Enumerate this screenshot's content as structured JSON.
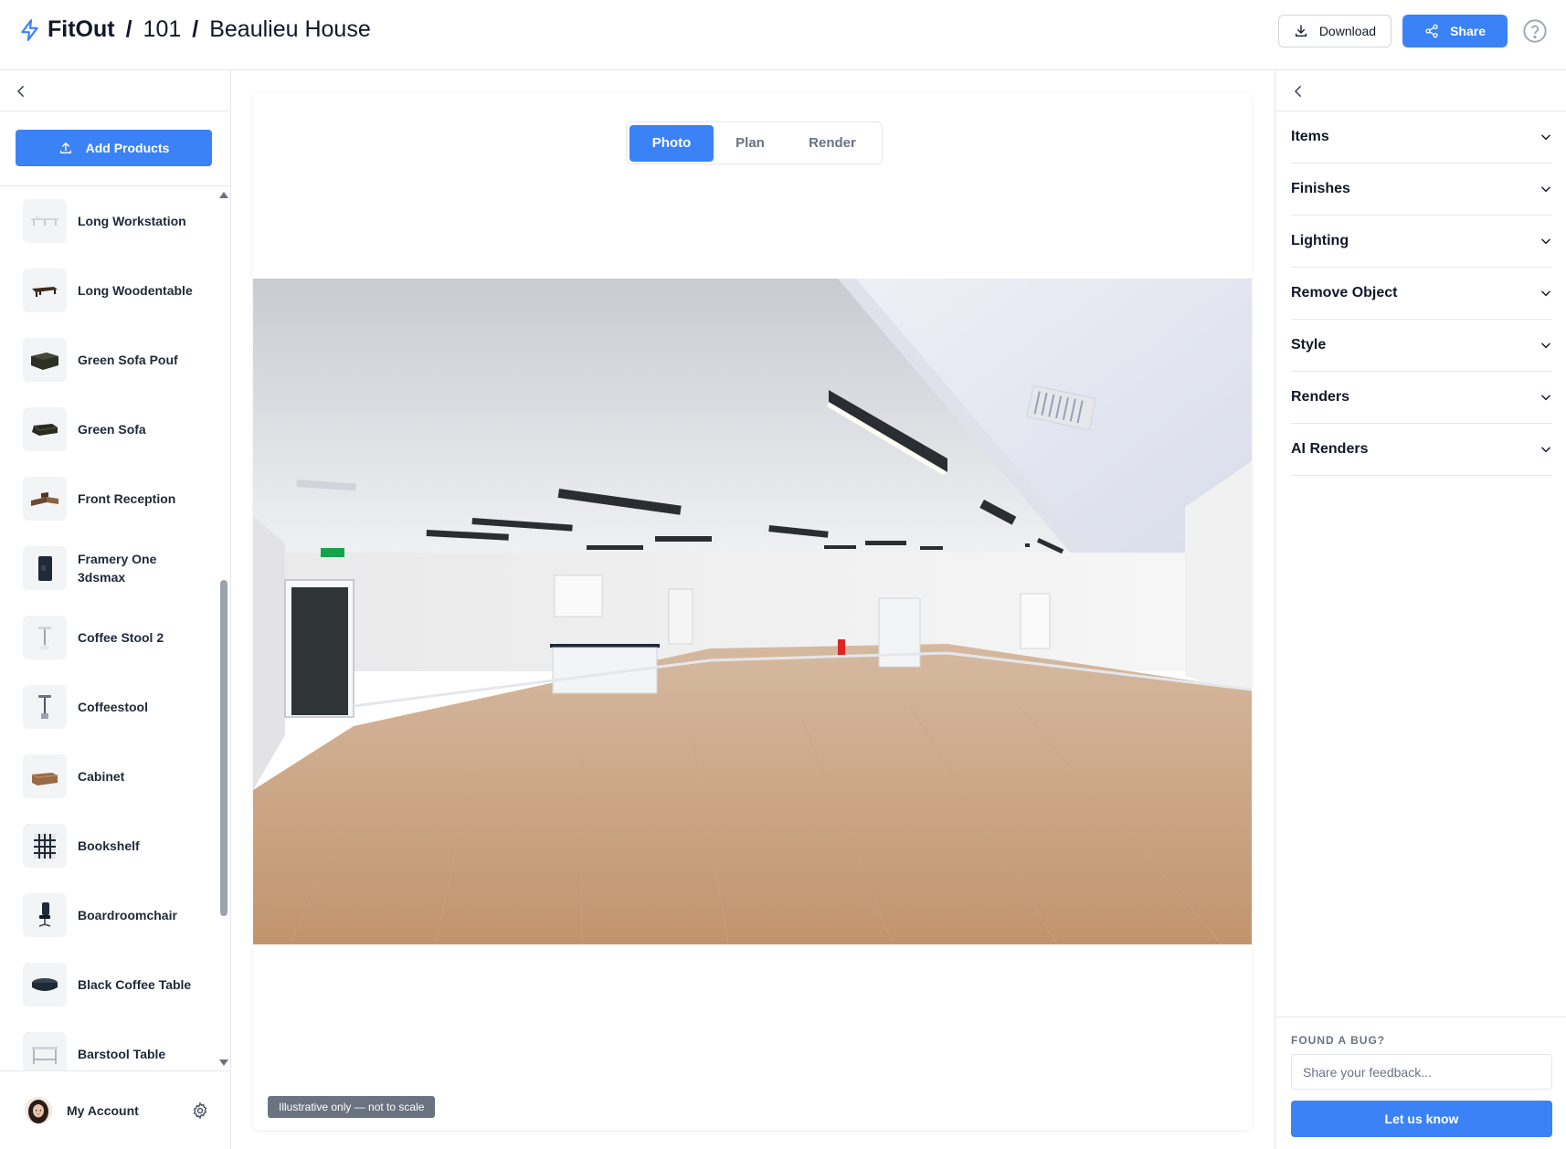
{
  "header": {
    "app_name": "FitOut",
    "separator": "/",
    "project_number": "101",
    "project_name": "Beaulieu House",
    "download_label": "Download",
    "share_label": "Share"
  },
  "left_sidebar": {
    "add_products_label": "Add Products",
    "products": [
      {
        "name": "Long Workstation"
      },
      {
        "name": "Long Woodentable"
      },
      {
        "name": "Green Sofa Pouf"
      },
      {
        "name": "Green Sofa"
      },
      {
        "name": "Front Reception"
      },
      {
        "name": "Framery One 3dsmax"
      },
      {
        "name": "Coffee Stool 2"
      },
      {
        "name": "Coffeestool"
      },
      {
        "name": "Cabinet"
      },
      {
        "name": "Bookshelf"
      },
      {
        "name": "Boardroomchair"
      },
      {
        "name": "Black Coffee Table"
      },
      {
        "name": "Barstool Table"
      }
    ],
    "account_label": "My Account"
  },
  "center": {
    "tabs": [
      "Photo",
      "Plan",
      "Render"
    ],
    "active_tab": "Photo",
    "disclaimer": "Illustrative only — not to scale"
  },
  "right_panel": {
    "sections": [
      "Items",
      "Finishes",
      "Lighting",
      "Remove Object",
      "Style",
      "Renders",
      "AI Renders"
    ],
    "feedback_title": "FOUND A BUG?",
    "feedback_placeholder": "Share your feedback...",
    "feedback_button": "Let us know"
  },
  "colors": {
    "accent": "#3b82f6",
    "border": "#e5e7eb",
    "text": "#111827",
    "muted": "#6b7280"
  }
}
